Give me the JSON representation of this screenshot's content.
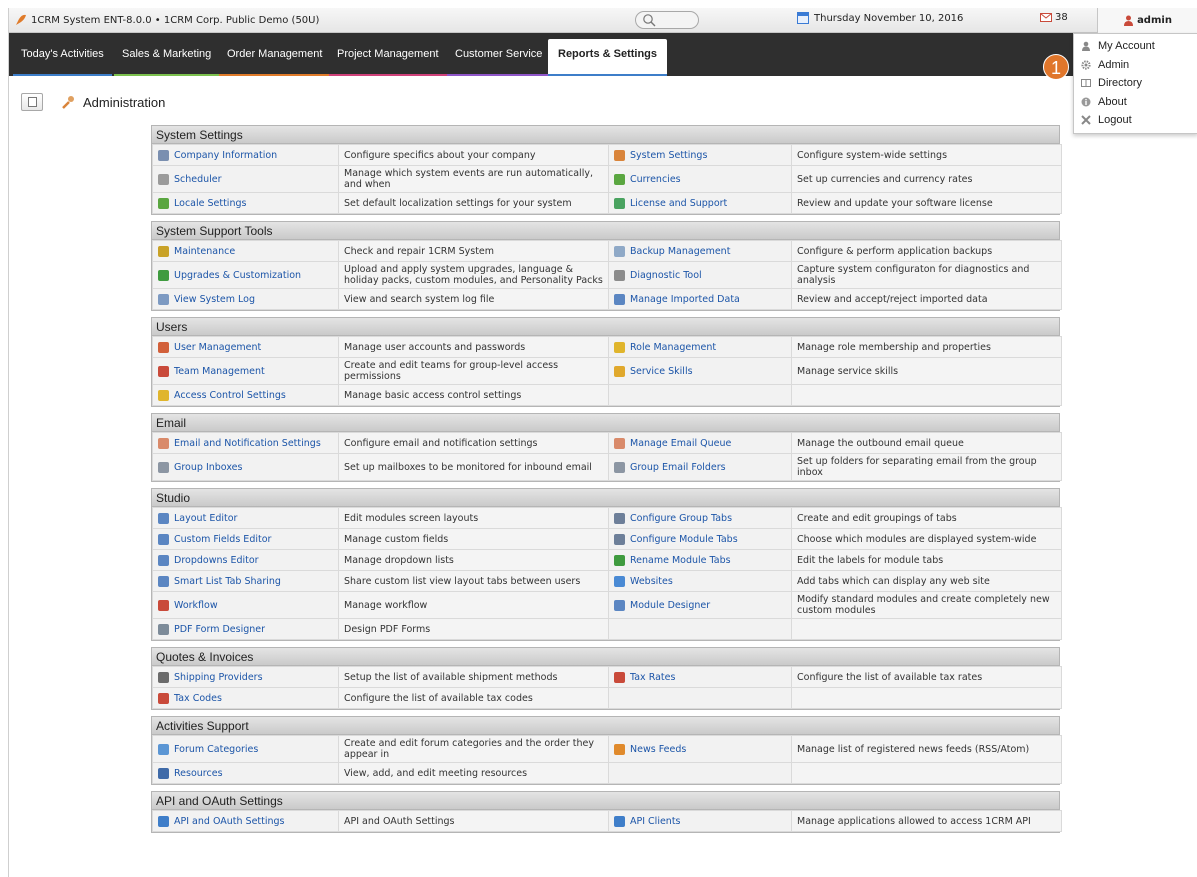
{
  "topbar": {
    "title": "1CRM System ENT-8.0.0 • 1CRM Corp. Public Demo (50U)",
    "date": "Thursday November 10, 2016",
    "mail_count": "38",
    "user": "admin"
  },
  "nav": {
    "tabs": [
      {
        "label": "Today's Activities"
      },
      {
        "label": "Sales & Marketing"
      },
      {
        "label": "Order Management"
      },
      {
        "label": "Project Management"
      },
      {
        "label": "Customer Service"
      },
      {
        "label": "Reports & Settings"
      }
    ]
  },
  "page": {
    "title": "Administration"
  },
  "user_menu": {
    "items": [
      {
        "label": "My Account",
        "icon": "user-icon"
      },
      {
        "label": "Admin",
        "icon": "gear-icon"
      },
      {
        "label": "Directory",
        "icon": "directory-icon"
      },
      {
        "label": "About",
        "icon": "info-icon"
      },
      {
        "label": "Logout",
        "icon": "logout-icon"
      }
    ],
    "badge": "1"
  },
  "sections": [
    {
      "title": "System Settings",
      "rows": [
        [
          {
            "label": "Company Information",
            "desc": "Configure specifics about your company",
            "icon": "#7a8fb0"
          },
          {
            "label": "System Settings",
            "desc": "Configure system-wide settings",
            "icon": "#d9843a"
          }
        ],
        [
          {
            "label": "Scheduler",
            "desc": "Manage which system events are run automatically, and when",
            "icon": "#9b9b9b"
          },
          {
            "label": "Currencies",
            "desc": "Set up currencies and currency rates",
            "icon": "#5aa640"
          }
        ],
        [
          {
            "label": "Locale Settings",
            "desc": "Set default localization settings for your system",
            "icon": "#5aa640"
          },
          {
            "label": "License and Support",
            "desc": "Review and update your software license",
            "icon": "#4aa360"
          }
        ]
      ]
    },
    {
      "title": "System Support Tools",
      "rows": [
        [
          {
            "label": "Maintenance",
            "desc": "Check and repair 1CRM System",
            "icon": "#c9a227"
          },
          {
            "label": "Backup Management",
            "desc": "Configure & perform application backups",
            "icon": "#8fa9c7"
          }
        ],
        [
          {
            "label": "Upgrades & Customization",
            "desc": "Upload and apply system upgrades, language & holiday packs, custom modules, and Personality Packs",
            "icon": "#3f9b3f"
          },
          {
            "label": "Diagnostic Tool",
            "desc": "Capture system configuraton for diagnostics and analysis",
            "icon": "#8c8c8c"
          }
        ],
        [
          {
            "label": "View System Log",
            "desc": "View and search system log file",
            "icon": "#7d9ac2"
          },
          {
            "label": "Manage Imported Data",
            "desc": "Review and accept/reject imported data",
            "icon": "#5b86c2"
          }
        ]
      ]
    },
    {
      "title": "Users",
      "rows": [
        [
          {
            "label": "User Management",
            "desc": "Manage user accounts and passwords",
            "icon": "#d2603a"
          },
          {
            "label": "Role Management",
            "desc": "Manage role membership and properties",
            "icon": "#e0b52c"
          }
        ],
        [
          {
            "label": "Team Management",
            "desc": "Create and edit teams for group-level access permissions",
            "icon": "#c94a3a"
          },
          {
            "label": "Service Skills",
            "desc": "Manage service skills",
            "icon": "#e0a82c"
          }
        ],
        [
          {
            "label": "Access Control Settings",
            "desc": "Manage basic access control settings",
            "icon": "#e0b52c"
          },
          {
            "label": "",
            "desc": "",
            "icon": ""
          }
        ]
      ]
    },
    {
      "title": "Email",
      "rows": [
        [
          {
            "label": "Email and Notification Settings",
            "desc": "Configure email and notification settings",
            "icon": "#d98a6a"
          },
          {
            "label": "Manage Email Queue",
            "desc": "Manage the outbound email queue",
            "icon": "#d98a6a"
          }
        ],
        [
          {
            "label": "Group Inboxes",
            "desc": "Set up mailboxes to be monitored for inbound email",
            "icon": "#8c96a3"
          },
          {
            "label": "Group Email Folders",
            "desc": "Set up folders for separating email from the group inbox",
            "icon": "#8c96a3"
          }
        ]
      ]
    },
    {
      "title": "Studio",
      "rows": [
        [
          {
            "label": "Layout Editor",
            "desc": "Edit modules screen layouts",
            "icon": "#5b86c2"
          },
          {
            "label": "Configure Group Tabs",
            "desc": "Create and edit groupings of tabs",
            "icon": "#6d7f99"
          }
        ],
        [
          {
            "label": "Custom Fields Editor",
            "desc": "Manage custom fields",
            "icon": "#5b86c2"
          },
          {
            "label": "Configure Module Tabs",
            "desc": "Choose which modules are displayed system-wide",
            "icon": "#6d7f99"
          }
        ],
        [
          {
            "label": "Dropdowns Editor",
            "desc": "Manage dropdown lists",
            "icon": "#5b86c2"
          },
          {
            "label": "Rename Module Tabs",
            "desc": "Edit the labels for module tabs",
            "icon": "#3f9b3f"
          }
        ],
        [
          {
            "label": "Smart List Tab Sharing",
            "desc": "Share custom list view layout tabs between users",
            "icon": "#5b86c2"
          },
          {
            "label": "Websites",
            "desc": "Add tabs which can display any web site",
            "icon": "#4a8ad4"
          }
        ],
        [
          {
            "label": "Workflow",
            "desc": "Manage workflow",
            "icon": "#c94a3a"
          },
          {
            "label": "Module Designer",
            "desc": "Modify standard modules and create completely new custom modules",
            "icon": "#5b86c2"
          }
        ],
        [
          {
            "label": "PDF Form Designer",
            "desc": "Design PDF Forms",
            "icon": "#7d8b99"
          },
          {
            "label": "",
            "desc": "",
            "icon": ""
          }
        ]
      ]
    },
    {
      "title": "Quotes & Invoices",
      "rows": [
        [
          {
            "label": "Shipping Providers",
            "desc": "Setup the list of available shipment methods",
            "icon": "#6b6b6b"
          },
          {
            "label": "Tax Rates",
            "desc": "Configure the list of available tax rates",
            "icon": "#c94a3a"
          }
        ],
        [
          {
            "label": "Tax Codes",
            "desc": "Configure the list of available tax codes",
            "icon": "#c94a3a"
          },
          {
            "label": "",
            "desc": "",
            "icon": ""
          }
        ]
      ]
    },
    {
      "title": "Activities Support",
      "rows": [
        [
          {
            "label": "Forum Categories",
            "desc": "Create and edit forum categories and the order they appear in",
            "icon": "#5b96d4"
          },
          {
            "label": "News Feeds",
            "desc": "Manage list of registered news feeds (RSS/Atom)",
            "icon": "#e08a2c"
          }
        ],
        [
          {
            "label": "Resources",
            "desc": "View, add, and edit meeting resources",
            "icon": "#3f6aa8"
          },
          {
            "label": "",
            "desc": "",
            "icon": ""
          }
        ]
      ]
    },
    {
      "title": "API and OAuth Settings",
      "rows": [
        [
          {
            "label": "API and OAuth Settings",
            "desc": "API and OAuth Settings",
            "icon": "#3f7ec9"
          },
          {
            "label": "API Clients",
            "desc": "Manage applications allowed to access 1CRM API",
            "icon": "#3f7ec9"
          }
        ]
      ]
    }
  ]
}
